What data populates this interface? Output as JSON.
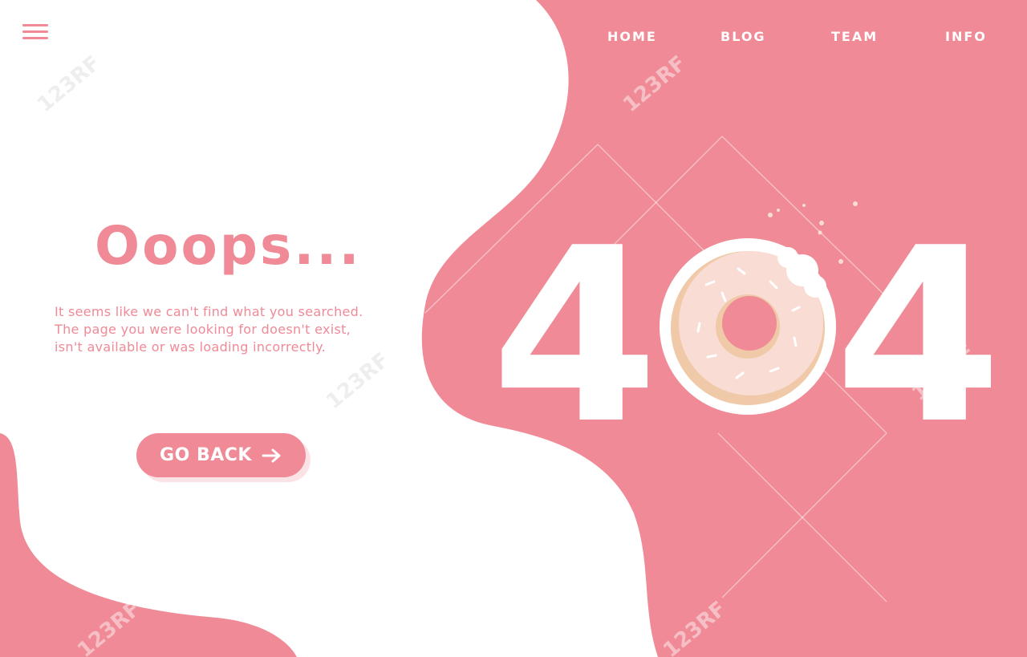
{
  "nav": {
    "menu_icon": "hamburger-menu-icon",
    "items": [
      {
        "label": "HOME"
      },
      {
        "label": "BLOG"
      },
      {
        "label": "TEAM"
      },
      {
        "label": "INFO"
      }
    ]
  },
  "main": {
    "title": "Ooops...",
    "description_lines": [
      "It seems like we can't find what you searched.",
      "The page you were looking for doesn't exist,",
      "isn't available or was loading incorrectly."
    ],
    "go_back_label": "GO BACK",
    "go_back_icon": "arrow-right-icon"
  },
  "error": {
    "digit_left": "4",
    "digit_right": "4",
    "middle_icon": "donut-icon"
  },
  "watermark": {
    "text": "123RF"
  },
  "colors": {
    "accent": "#ef8a96",
    "background": "#ffffff",
    "donut_frosting": "#f9dcd4",
    "donut_dough": "#efc9a8"
  }
}
